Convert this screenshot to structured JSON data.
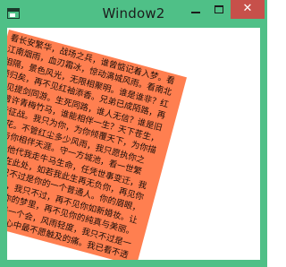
{
  "window": {
    "title": "Window2",
    "close_glyph": "✕",
    "colors": {
      "frame": "#4fc087",
      "close_button": "#c7504a",
      "panel": "#ff7f50",
      "client": "#ffffff"
    },
    "icons": [
      "app-icon",
      "minimize-icon",
      "maximize-icon",
      "close-icon"
    ]
  },
  "panel": {
    "rotation_deg": 15,
    "text": "看长安繁华，战场之兵，谁曾惦记着入梦。看江南烟雨，血刃霜冰，惊动满城风雨。看南北相隔，景色风光，无限相聚明。谁是谁非？红颜归矣，再不见红袖添香。兄弟已成陌路，再不见提剑同游。生死同路，谁人无信？谁是旧日曾许青梅竹马，谁能相伴一生？天下苍生，不皆征战。我只为你，为你倾覆天下，为你描绘桃花。不管红尘多少风雨，我只愿执你之手，与你相伴天涯。守一方城池，看一世繁华，让他代我走牛马生命，任凭世事变迁，我只身站在此处，如若我此生再无负你，再见你时，我只不过是你的一个普通人。你的眉眼，你的笑颜，我只不过，再不见你如新婚妆。让他重新入你的梦里，再不见你的纯真与美丽。我只不过是一个会，风雨轻度，我只不过是一个你，是我心中最不愿触及的痛。我已看不透"
  }
}
